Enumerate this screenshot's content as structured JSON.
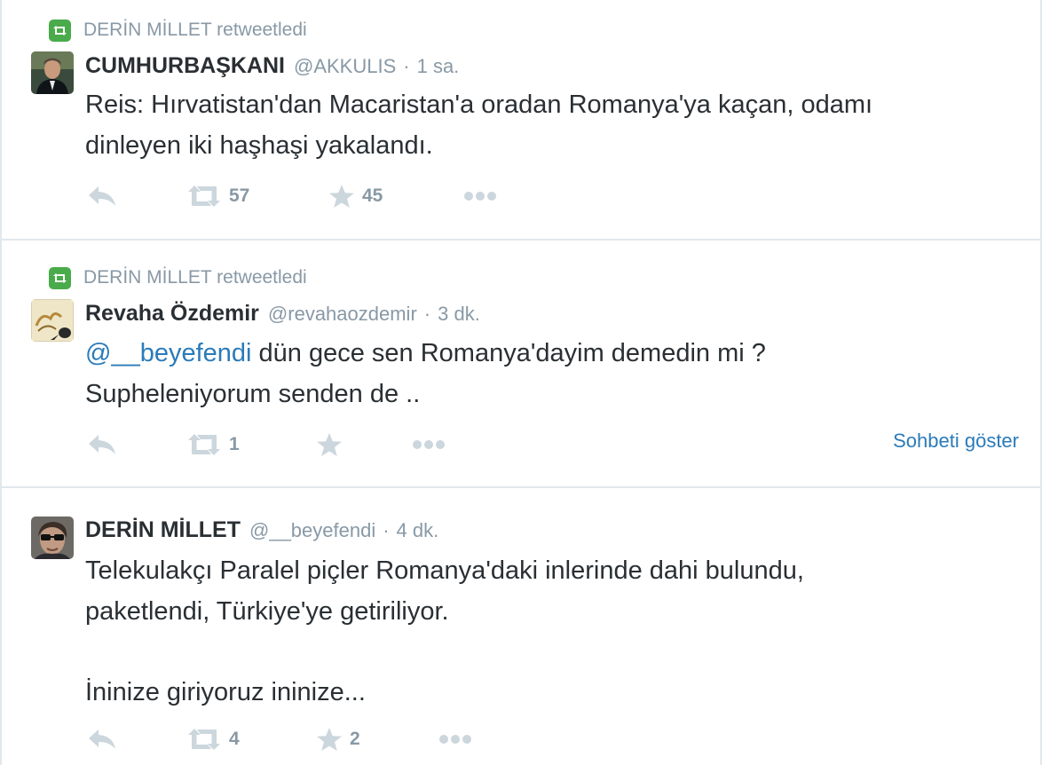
{
  "tweets": [
    {
      "retweeted_by": "DERİN MİLLET retweetledi",
      "fullname": "CUMHURBAŞKANI",
      "handle": "@AKKULIS",
      "separator": "·",
      "time": "1 sa.",
      "text_lines": [
        "Reis: Hırvatistan'dan Macaristan'a oradan Romanya'ya kaçan, odamı",
        "dinleyen iki haşhaşi yakalandı."
      ],
      "retweet_count": "57",
      "favorite_count": "45"
    },
    {
      "retweeted_by": "DERİN MİLLET retweetledi",
      "fullname": "Revaha Özdemir",
      "handle": "@revahaozdemir",
      "separator": "·",
      "time": "3 dk.",
      "mention": "@__beyefendi",
      "text_line1_rest": " dün gece sen Romanya'dayim demedin mi ?",
      "text_line2": "Supheleniyorum senden de ..",
      "retweet_count": "1",
      "favorite_count": "",
      "conversation_link": "Sohbeti göster"
    },
    {
      "fullname": "DERİN MİLLET",
      "handle": "@__beyefendi",
      "separator": "·",
      "time": "4 dk.",
      "text_lines": [
        "Telekulakçı Paralel piçler Romanya'daki inlerinde dahi bulundu,",
        "paketlendi, Türkiye'ye getiriliyor.",
        "İninize giriyoruz ininize..."
      ],
      "retweet_count": "4",
      "favorite_count": "2"
    }
  ],
  "colors": {
    "retweet_badge": "#4aab4a",
    "link": "#2b7bb9",
    "muted": "#8899a6",
    "action_icon": "#ccd6dd"
  }
}
